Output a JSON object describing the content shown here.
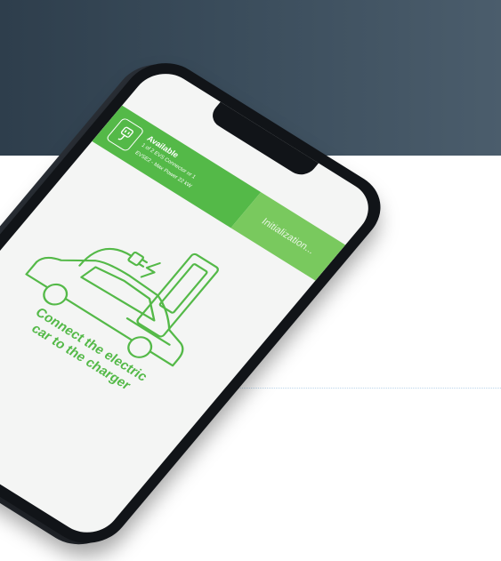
{
  "status": {
    "title": "Available",
    "line1": "1 of 2 EVS Connector nr 1",
    "line2": "EVSE2 - Max Power 22 kW",
    "init_label": "Initialization..."
  },
  "caption": {
    "line1": "Connect the electric",
    "line2": "car to the charger"
  },
  "colors": {
    "brand_green": "#54b948",
    "init_green": "#79c95e",
    "header_dark": "#2e3e4c"
  },
  "icons": {
    "plug": "plug-icon",
    "charger": "charging-station-icon",
    "car": "electric-car-icon",
    "bolt": "lightning-icon"
  }
}
